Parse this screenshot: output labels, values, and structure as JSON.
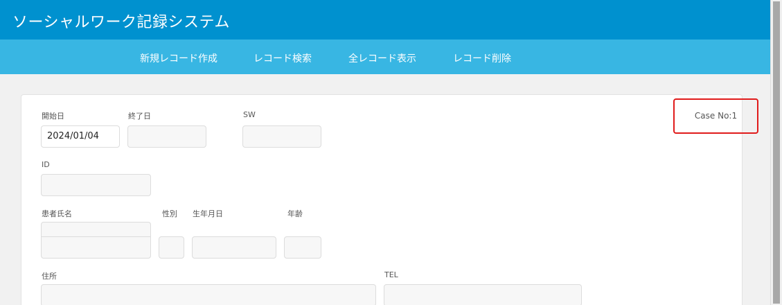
{
  "header": {
    "title": "ソーシャルワーク記録システム"
  },
  "nav": {
    "items": [
      {
        "label": "新規レコード作成"
      },
      {
        "label": "レコード検索"
      },
      {
        "label": "全レコード表示"
      },
      {
        "label": "レコード削除"
      }
    ]
  },
  "form": {
    "start_date": {
      "label": "開始日",
      "value": "2024/01/04"
    },
    "end_date": {
      "label": "終了日",
      "value": ""
    },
    "sw": {
      "label": "SW",
      "value": ""
    },
    "id": {
      "label": "ID",
      "value": ""
    },
    "patient_name": {
      "label": "患者氏名",
      "value": ""
    },
    "gender": {
      "label": "性別",
      "value": ""
    },
    "birth_date": {
      "label": "生年月日",
      "value": ""
    },
    "age": {
      "label": "年齢",
      "value": ""
    },
    "address": {
      "label": "住所",
      "value": ""
    },
    "tel": {
      "label": "TEL",
      "value": ""
    },
    "case_no": "Case No:1"
  }
}
